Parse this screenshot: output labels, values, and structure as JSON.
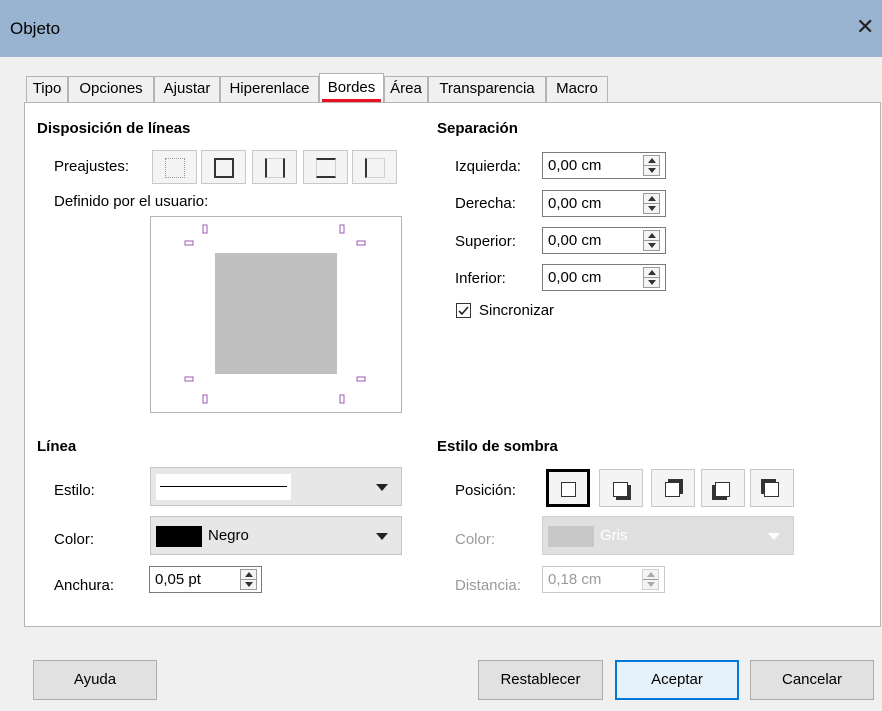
{
  "window": {
    "title": "Objeto"
  },
  "tabs": [
    "Tipo",
    "Opciones",
    "Ajustar",
    "Hiperenlace",
    "Bordes",
    "Área",
    "Transparencia",
    "Macro"
  ],
  "active_tab": "Bordes",
  "line_arrangement": {
    "heading": "Disposición de líneas",
    "presets_label": "Preajustes:",
    "user_defined_label": "Definido por el usuario:"
  },
  "spacing": {
    "heading": "Separación",
    "left_label": "Izquierda:",
    "left_value": "0,00 cm",
    "right_label": "Derecha:",
    "right_value": "0,00 cm",
    "top_label": "Superior:",
    "top_value": "0,00 cm",
    "bottom_label": "Inferior:",
    "bottom_value": "0,00 cm",
    "sync_label": "Sincronizar",
    "sync_checked": true
  },
  "line": {
    "heading": "Línea",
    "style_label": "Estilo:",
    "color_label": "Color:",
    "color_value": "Negro",
    "color_swatch": "#000000",
    "width_label": "Anchura:",
    "width_value": "0,05 pt"
  },
  "shadow": {
    "heading": "Estilo de sombra",
    "position_label": "Posición:",
    "color_label": "Color:",
    "color_value": "Gris",
    "color_swatch": "#c0c0c0",
    "distance_label": "Distancia:",
    "distance_value": "0,18 cm"
  },
  "buttons": {
    "help": "Ayuda",
    "reset": "Restablecer",
    "ok": "Aceptar",
    "cancel": "Cancelar"
  }
}
